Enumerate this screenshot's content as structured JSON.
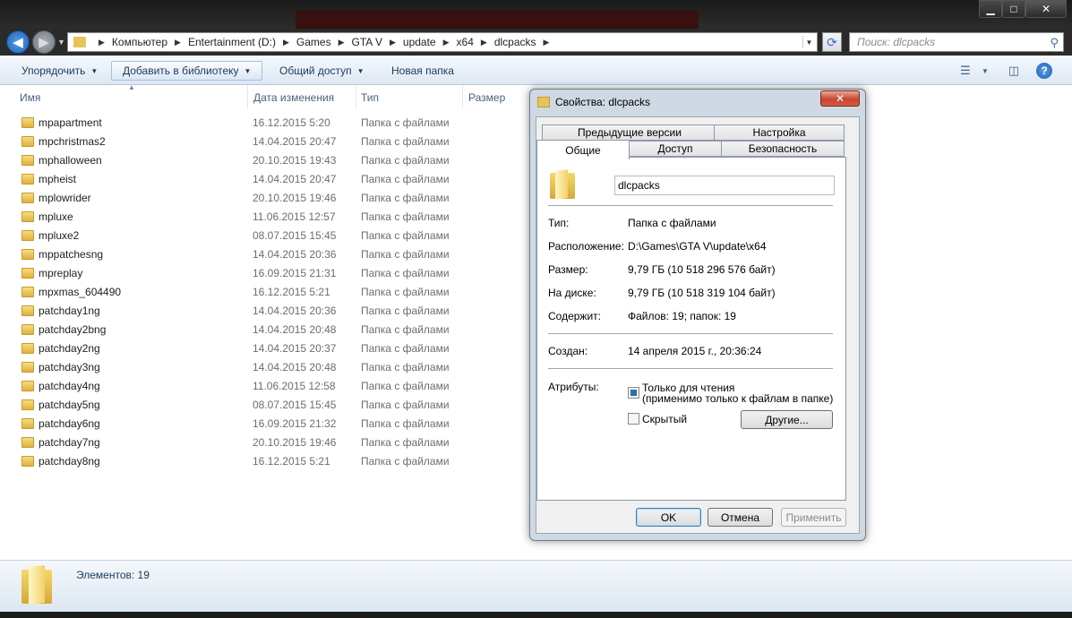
{
  "address": {
    "crumbs": [
      "Компьютер",
      "Entertainment (D:)",
      "Games",
      "GTA V",
      "update",
      "x64",
      "dlcpacks"
    ],
    "search_placeholder": "Поиск: dlcpacks"
  },
  "toolbar": {
    "organize": "Упорядочить",
    "add_to_library": "Добавить в библиотеку",
    "share": "Общий доступ",
    "new_folder": "Новая папка"
  },
  "columns": {
    "name": "Имя",
    "date": "Дата изменения",
    "type": "Тип",
    "size": "Размер"
  },
  "files": [
    {
      "name": "mpapartment",
      "date": "16.12.2015 5:20",
      "type": "Папка с файлами"
    },
    {
      "name": "mpchristmas2",
      "date": "14.04.2015 20:47",
      "type": "Папка с файлами"
    },
    {
      "name": "mphalloween",
      "date": "20.10.2015 19:43",
      "type": "Папка с файлами"
    },
    {
      "name": "mpheist",
      "date": "14.04.2015 20:47",
      "type": "Папка с файлами"
    },
    {
      "name": "mplowrider",
      "date": "20.10.2015 19:46",
      "type": "Папка с файлами"
    },
    {
      "name": "mpluxe",
      "date": "11.06.2015 12:57",
      "type": "Папка с файлами"
    },
    {
      "name": "mpluxe2",
      "date": "08.07.2015 15:45",
      "type": "Папка с файлами"
    },
    {
      "name": "mppatchesng",
      "date": "14.04.2015 20:36",
      "type": "Папка с файлами"
    },
    {
      "name": "mpreplay",
      "date": "16.09.2015 21:31",
      "type": "Папка с файлами"
    },
    {
      "name": "mpxmas_604490",
      "date": "16.12.2015 5:21",
      "type": "Папка с файлами"
    },
    {
      "name": "patchday1ng",
      "date": "14.04.2015 20:36",
      "type": "Папка с файлами"
    },
    {
      "name": "patchday2bng",
      "date": "14.04.2015 20:48",
      "type": "Папка с файлами"
    },
    {
      "name": "patchday2ng",
      "date": "14.04.2015 20:37",
      "type": "Папка с файлами"
    },
    {
      "name": "patchday3ng",
      "date": "14.04.2015 20:48",
      "type": "Папка с файлами"
    },
    {
      "name": "patchday4ng",
      "date": "11.06.2015 12:58",
      "type": "Папка с файлами"
    },
    {
      "name": "patchday5ng",
      "date": "08.07.2015 15:45",
      "type": "Папка с файлами"
    },
    {
      "name": "patchday6ng",
      "date": "16.09.2015 21:32",
      "type": "Папка с файлами"
    },
    {
      "name": "patchday7ng",
      "date": "20.10.2015 19:46",
      "type": "Папка с файлами"
    },
    {
      "name": "patchday8ng",
      "date": "16.12.2015 5:21",
      "type": "Папка с файлами"
    }
  ],
  "status": {
    "items": "Элементов: 19"
  },
  "dialog": {
    "title": "Свойства: dlcpacks",
    "tabs": {
      "previous_versions": "Предыдущие версии",
      "customize": "Настройка",
      "general": "Общие",
      "sharing": "Доступ",
      "security": "Безопасность"
    },
    "folder_name": "dlcpacks",
    "labels": {
      "type": "Тип:",
      "location": "Расположение:",
      "size": "Размер:",
      "size_on_disk": "На диске:",
      "contains": "Содержит:",
      "created": "Создан:",
      "attributes": "Атрибуты:"
    },
    "values": {
      "type": "Папка с файлами",
      "location": "D:\\Games\\GTA V\\update\\x64",
      "size": "9,79 ГБ (10 518 296 576 байт)",
      "size_on_disk": "9,79 ГБ (10 518 319 104 байт)",
      "contains": "Файлов: 19; папок: 19",
      "created": "14 апреля 2015 г., 20:36:24"
    },
    "readonly_label": "Только для чтения",
    "readonly_note": "(применимо только к файлам в папке)",
    "hidden_label": "Скрытый",
    "other_button": "Другие...",
    "ok": "OK",
    "cancel": "Отмена",
    "apply": "Применить"
  }
}
